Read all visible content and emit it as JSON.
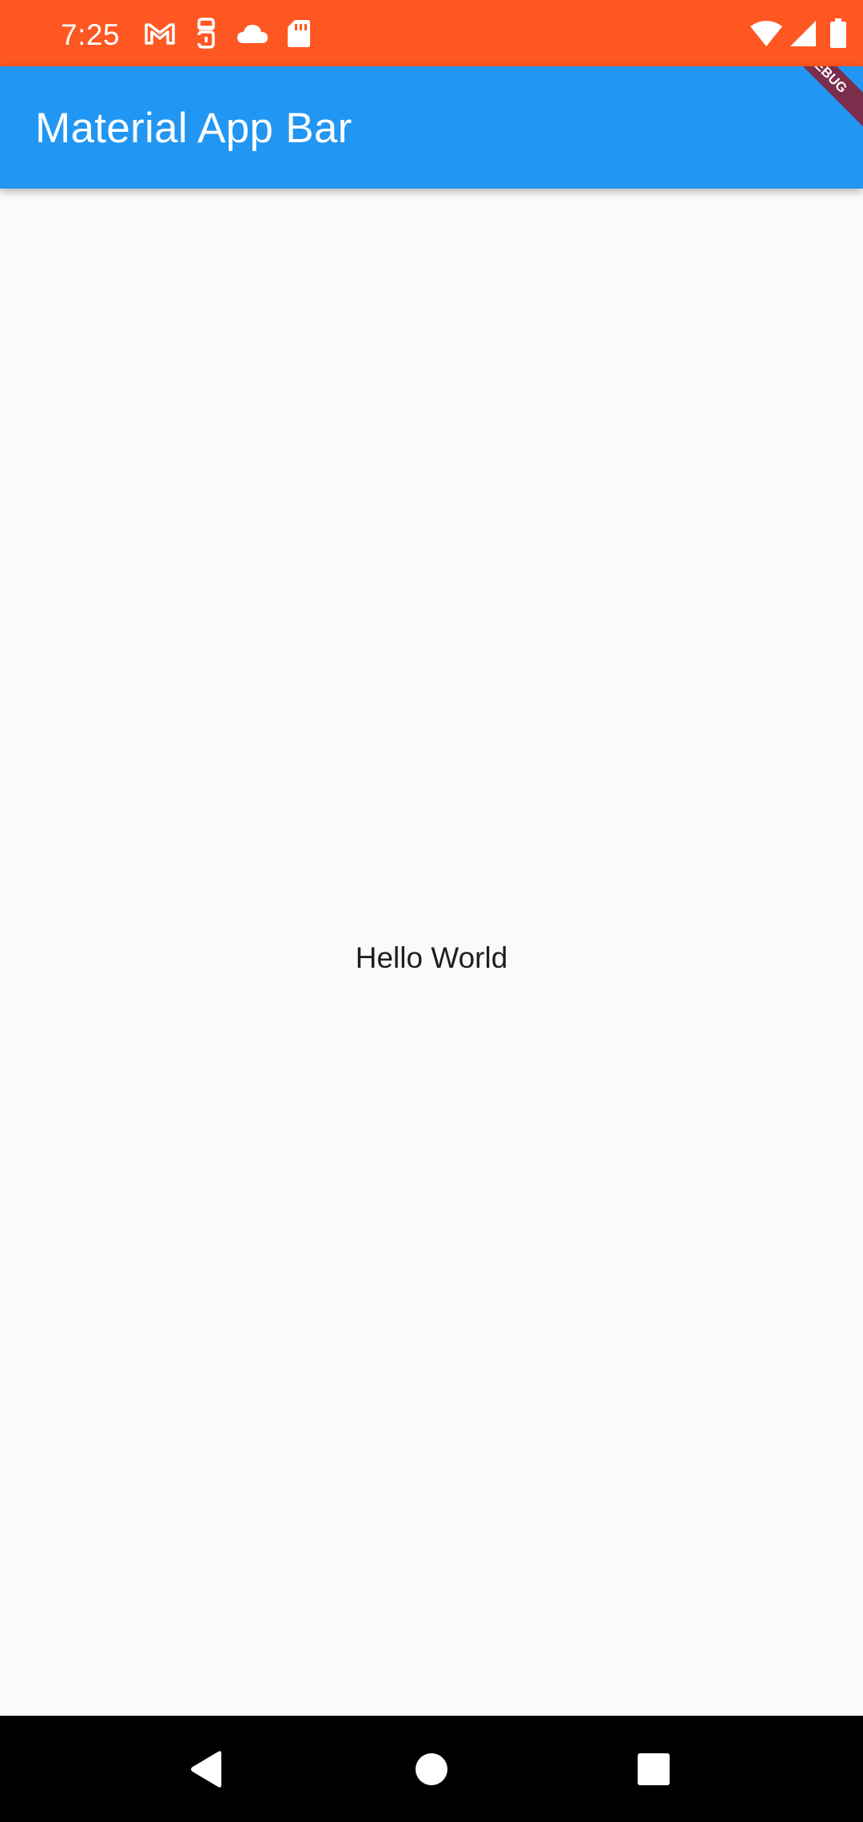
{
  "status_bar": {
    "time": "7:25",
    "background": "#ff5722",
    "left_icons": [
      "gmail-icon",
      "android-debug-icon",
      "cloud-icon",
      "sd-card-icon"
    ],
    "right_icons": [
      "wifi-icon",
      "cell-signal-icon",
      "battery-icon"
    ]
  },
  "app_bar": {
    "title": "Material App Bar",
    "background": "#2196f3",
    "debug_banner": "DEBUG"
  },
  "body": {
    "text": "Hello World",
    "background": "#fafafa"
  },
  "nav_bar": {
    "buttons": [
      "back-icon",
      "home-icon",
      "recents-icon"
    ]
  }
}
